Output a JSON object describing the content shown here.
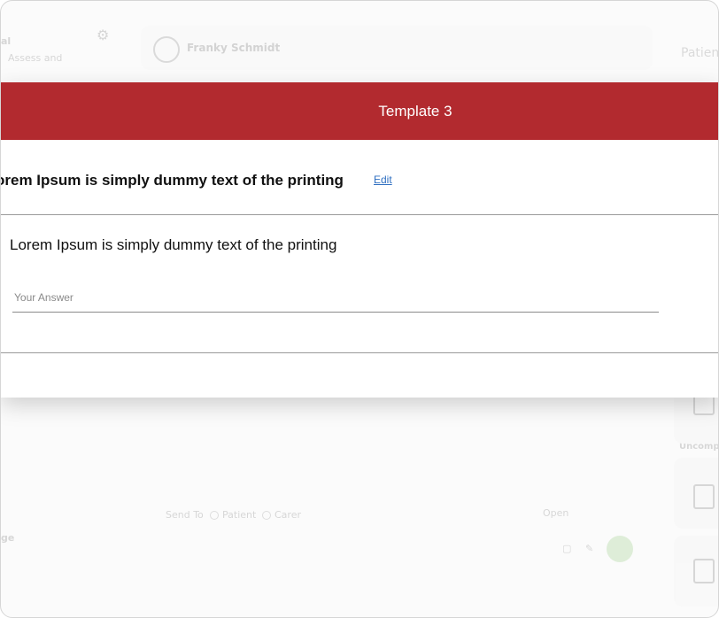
{
  "modal": {
    "title": "Template 3",
    "question_title": "orem Ipsum is simply dummy text of the printing",
    "edit_label": "Edit",
    "question_text": "Lorem Ipsum is simply dummy text of the printing",
    "answer_placeholder": "Your Answer",
    "answer_value": ""
  },
  "background": {
    "user_name": "Franky Schmidt",
    "section_label": "Patien",
    "uncompleted_label": "Uncompl",
    "send_to_label": "Send To",
    "patient_option": "Patient",
    "carer_option": "Carer",
    "open_label": "Open",
    "message_label": "ge",
    "top_left_label": "al",
    "top_left_sub": "Assess and"
  },
  "colors": {
    "header_bg": "#b22a2f",
    "link": "#2f6fc1",
    "send_button": "#7cbf62"
  }
}
